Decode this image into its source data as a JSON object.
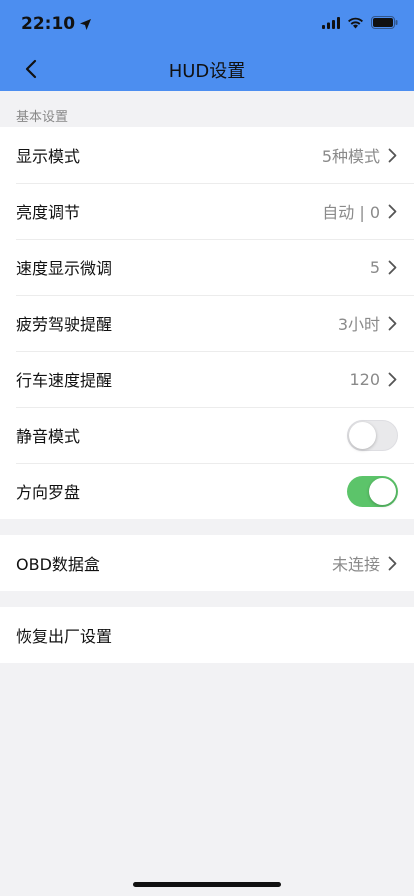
{
  "status_bar": {
    "time": "22:10",
    "icons": [
      "location-arrow-icon",
      "signal-icon",
      "wifi-icon",
      "battery-icon"
    ]
  },
  "nav": {
    "title": "HUD设置",
    "back_icon": "chevron-left-icon"
  },
  "colors": {
    "header_bg": "#4c8ef0",
    "toggle_on": "#5cc46a",
    "background": "#f2f2f4"
  },
  "basic_settings": {
    "caption": "基本设置",
    "rows": [
      {
        "label": "显示模式",
        "value": "5种模式"
      },
      {
        "label": "亮度调节",
        "value": "自动 | 0"
      },
      {
        "label": "速度显示微调",
        "value": "5"
      },
      {
        "label": "疲劳驾驶提醒",
        "value": "3小时"
      },
      {
        "label": "行车速度提醒",
        "value": "120"
      }
    ],
    "toggles": [
      {
        "label": "静音模式",
        "state": "off"
      },
      {
        "label": "方向罗盘",
        "state": "on"
      }
    ]
  },
  "obd": {
    "label": "OBD数据盒",
    "value": "未连接"
  },
  "reset": {
    "label": "恢复出厂设置"
  }
}
